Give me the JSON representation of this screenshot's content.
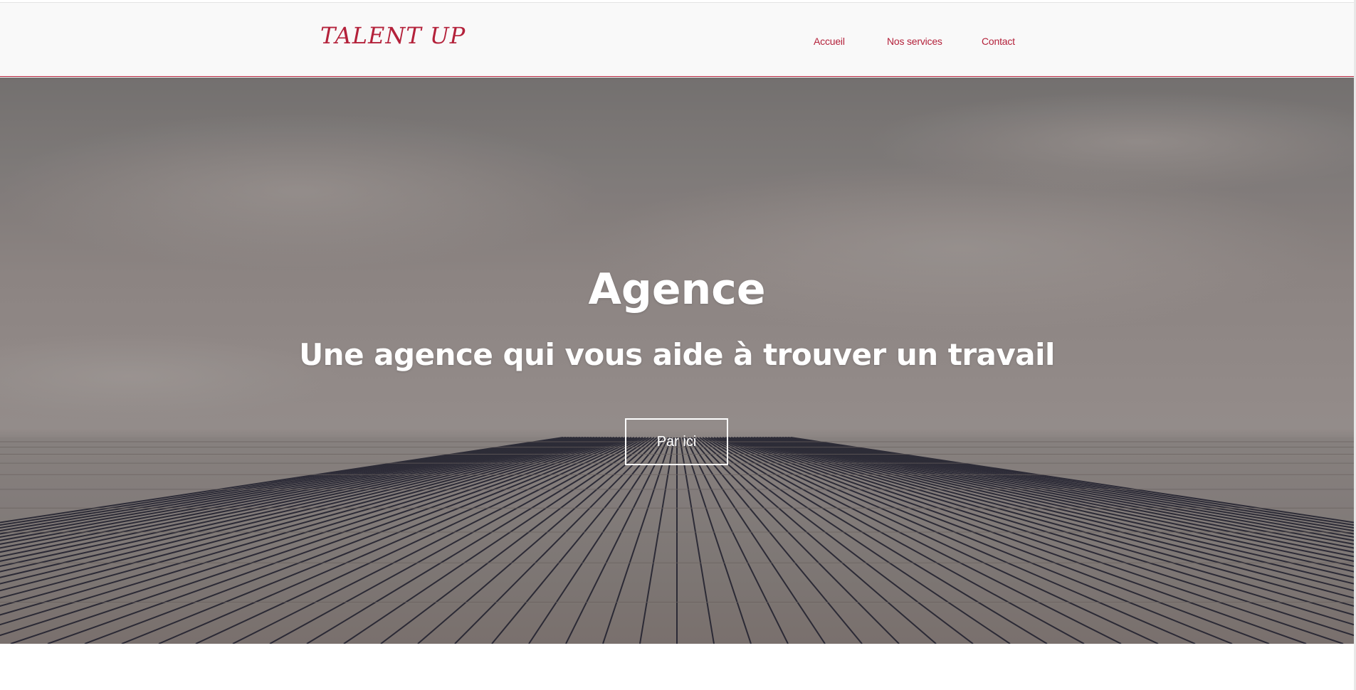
{
  "navbar": {
    "brand": "TALENT UP",
    "links": [
      {
        "label": "Accueil"
      },
      {
        "label": "Nos services"
      },
      {
        "label": "Contact"
      }
    ]
  },
  "hero": {
    "title": "Agence",
    "subtitle": "Une agence qui vous aide à trouver un travail",
    "button_label": "Par ici",
    "background_image": "wooden-pier-under-cloudy-sky"
  },
  "colors": {
    "accent": "#b4223b",
    "navbar_bg": "#f9f9f9",
    "hero_text": "#ffffff"
  }
}
